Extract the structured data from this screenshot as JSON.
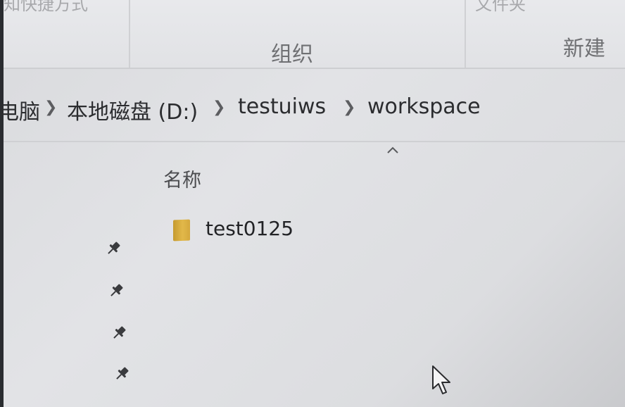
{
  "ribbon": {
    "top_left_partial": "知快捷方式",
    "top_right_partial": "文件夹",
    "group_organize": "组织",
    "group_new": "新建"
  },
  "breadcrumb": {
    "this_pc_partial": "电脑",
    "drive": "本地磁盘 (D:)",
    "folder1": "testuiws",
    "folder2": "workspace"
  },
  "file_list": {
    "column_name": "名称",
    "sort_icon": "chevron-up-icon",
    "items": [
      {
        "name": "test0125",
        "icon": "folder-icon"
      }
    ]
  },
  "quick_access": {
    "pins": [
      "pin-icon",
      "pin-icon",
      "pin-icon",
      "pin-icon"
    ]
  },
  "colors": {
    "folder": "#e2b84a",
    "text": "#2b2c2f",
    "background": "#e2e3e6"
  }
}
